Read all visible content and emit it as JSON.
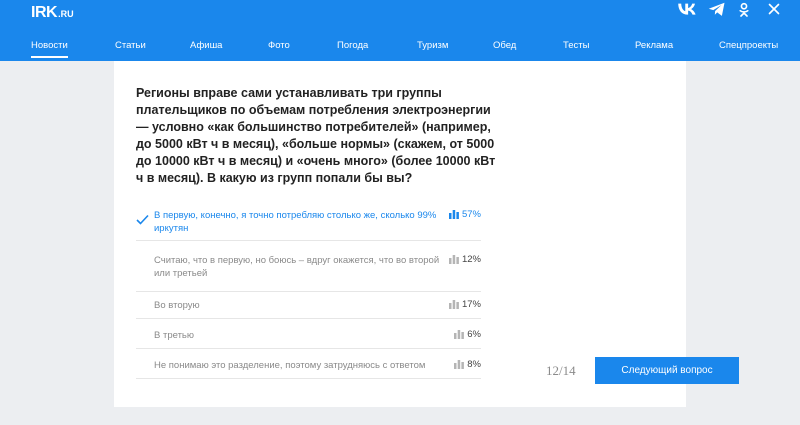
{
  "header": {
    "logo": {
      "main": "IRK",
      "suffix": ".RU"
    },
    "socials": [
      "vk-icon",
      "telegram-icon",
      "odnoklassniki-icon",
      "close-icon"
    ],
    "nav": [
      "Новости",
      "Статьи",
      "Афиша",
      "Фото",
      "Погода",
      "Туризм",
      "Обед",
      "Тесты",
      "Реклама",
      "Спецпроекты"
    ],
    "active_nav": "Новости"
  },
  "poll": {
    "question": "Регионы вправе сами устанавливать три группы плательщиков по объемам потребления электроэнергии — условно «как большинство потребителей» (например, до 5000 кВт ч в месяц), «больше нормы» (скажем, от 5000 до 10000 кВт ч в месяц) и «очень много» (более 10000 кВт ч в месяц). В какую из групп попали бы вы?",
    "options": [
      {
        "text": "В первую, конечно, я точно потребляю столько же, сколько 99% иркутян",
        "percent": "57%",
        "selected": true
      },
      {
        "text": "Считаю, что в первую, но боюсь – вдруг окажется, что во второй или третьей",
        "percent": "12%",
        "selected": false
      },
      {
        "text": "Во вторую",
        "percent": "17%",
        "selected": false
      },
      {
        "text": "В третью",
        "percent": "6%",
        "selected": false
      },
      {
        "text": "Не понимаю это разделение, поэтому затрудняюсь с ответом",
        "percent": "8%",
        "selected": false
      }
    ],
    "counter": "12/14",
    "next_label": "Следующий вопрос"
  },
  "colors": {
    "brand": "#1a87ec",
    "background": "#eceef1",
    "muted": "#8a8a8a"
  }
}
